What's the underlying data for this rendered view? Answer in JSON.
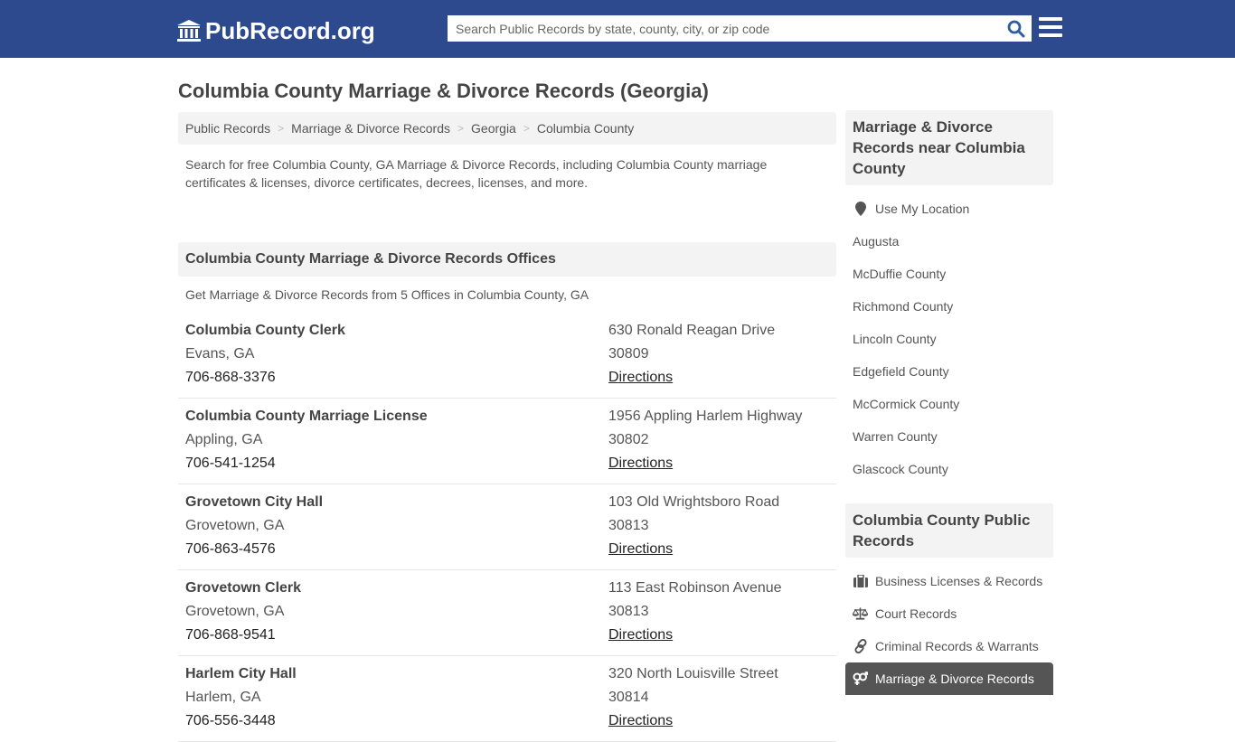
{
  "header": {
    "logo_text": "PubRecord.org",
    "search_placeholder": "Search Public Records by state, county, city, or zip code",
    "brand_color": "#2d4a8f"
  },
  "page": {
    "title": "Columbia County Marriage & Divorce Records (Georgia)"
  },
  "breadcrumb": [
    {
      "label": "Public Records"
    },
    {
      "label": "Marriage & Divorce Records"
    },
    {
      "label": "Georgia"
    },
    {
      "label": "Columbia County"
    }
  ],
  "intro": "Search for free Columbia County, GA Marriage & Divorce Records, including Columbia County marriage certificates & licenses, divorce certificates, decrees, licenses, and more.",
  "offices_section": {
    "heading": "Columbia County Marriage & Divorce Records Offices",
    "subtitle": "Get Marriage & Divorce Records from 5 Offices in Columbia County, GA",
    "offices": [
      {
        "name": "Columbia County Clerk",
        "city": "Evans, GA",
        "phone": "706-868-3376",
        "address": "630 Ronald Reagan Drive",
        "zip": "30809",
        "directions": "Directions"
      },
      {
        "name": "Columbia County Marriage License",
        "city": "Appling, GA",
        "phone": "706-541-1254",
        "address": "1956 Appling Harlem Highway",
        "zip": "30802",
        "directions": "Directions"
      },
      {
        "name": "Grovetown City Hall",
        "city": "Grovetown, GA",
        "phone": "706-863-4576",
        "address": "103 Old Wrightsboro Road",
        "zip": "30813",
        "directions": "Directions"
      },
      {
        "name": "Grovetown Clerk",
        "city": "Grovetown, GA",
        "phone": "706-868-9541",
        "address": "113 East Robinson Avenue",
        "zip": "30813",
        "directions": "Directions"
      },
      {
        "name": "Harlem City Hall",
        "city": "Harlem, GA",
        "phone": "706-556-3448",
        "address": "320 North Louisville Street",
        "zip": "30814",
        "directions": "Directions"
      }
    ]
  },
  "sidebar": {
    "nearby": {
      "heading": "Marriage & Divorce Records near Columbia County",
      "use_location": "Use My Location",
      "items": [
        "Augusta",
        "McDuffie County",
        "Richmond County",
        "Lincoln County",
        "Edgefield County",
        "McCormick County",
        "Warren County",
        "Glascock County"
      ]
    },
    "public_records": {
      "heading": "Columbia County Public Records",
      "items": [
        {
          "label": "Business Licenses & Records",
          "icon": "briefcase-icon"
        },
        {
          "label": "Court Records",
          "icon": "scales-icon"
        },
        {
          "label": "Criminal Records & Warrants",
          "icon": "link-icon"
        },
        {
          "label": "Marriage & Divorce Records",
          "icon": "venus-mars-icon",
          "active": true
        }
      ]
    }
  }
}
